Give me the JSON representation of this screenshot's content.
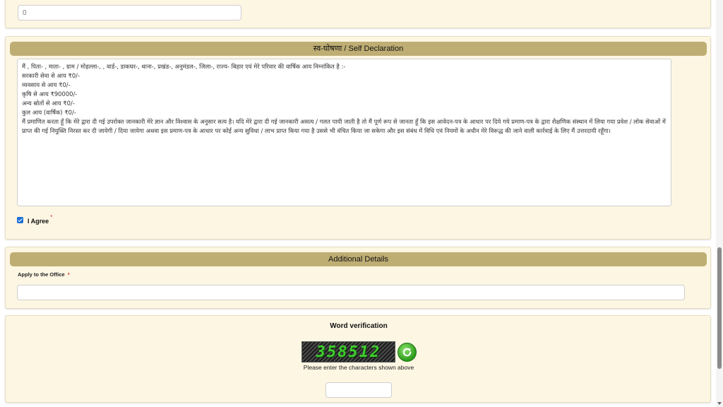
{
  "top_field": {
    "value": "0"
  },
  "self_declaration": {
    "header": "स्व-घोषणा / Self Declaration",
    "lines": [
      "मैं ,  पिता- , माता- ,  ग्राम / मोहल्ला-, , वार्ड-, डाकघर-, थाना-, प्रखंड-, अनुमंडल-, जिला-, राज्य- बिहार एवं मेरे परिवार की वार्षिक आय निम्नांकित है :-",
      "सरकारी सेवा से आय ₹0/-",
      "व्यवसाय से आय ₹0/-",
      "कृषि से आय ₹90000/-",
      "अन्य स्रोतों से आय ₹0/-",
      "कुल आय (वार्षिक) ₹0/-"
    ],
    "paragraph": "मैं  प्रमाणित करता हूँ कि मेरे द्वारा दी गई उपरोक्त जानकारी मेरे ज्ञान और विश्वास के अनुसार सत्य है। यदि मेरे द्वारा दी गई जानकारी असत्य / गलत पायी जाती है तो मैं पूर्ण रूप से जानता हूँ कि इस आवेदन-पत्र के आधार पर दिये गये प्रमाण-पत्र के द्वारा शैक्षणिक संस्थान में लिया गया प्रवेश / लोक सेवाओं में प्राप्त की गई नियुक्ति निरस्त कर दी जायेगी / दिया जायेगा अथवा इस प्रमाण-पत्र के आधार पर कोई अन्य सुविधा / लाभ प्राप्त किया गया है उससे भी वंचित किया जा सकेगा और इस संबंध में विधि एवं नियमों के अधीन मेरे विरूद्ध की जाने वाली कार्रवाई के लिए मैं उत्तरदायी रहूँगा।",
    "agree_label": "I Agree",
    "agree_checked": true,
    "required_mark": "*"
  },
  "additional_details": {
    "header": "Additional Details",
    "office_label": "Apply to the Office",
    "required_mark": "*",
    "office_value": ""
  },
  "word_verification": {
    "title": "Word verification",
    "captcha_text": "358512",
    "hint": "Please enter the characters shown above",
    "input_value": "",
    "refresh_icon": "refresh-icon"
  },
  "colors": {
    "card_bg": "#fdf6e3",
    "section_header_bg": "#bfae74",
    "captcha_text": "#3fcc2e",
    "required": "#d9302c",
    "checkbox": "#1f6fd6"
  }
}
